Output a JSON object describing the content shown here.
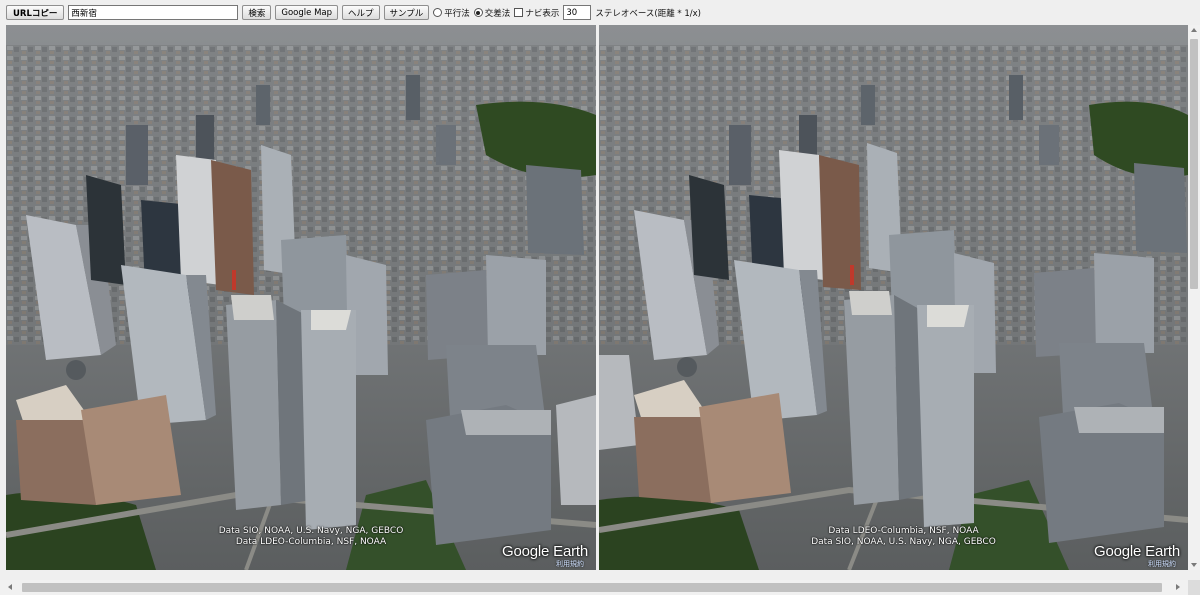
{
  "toolbar": {
    "url_copy_label": "URLコピー",
    "search_value": "西新宿",
    "search_button_label": "検索",
    "google_map_label": "Google Map",
    "help_label": "ヘルプ",
    "sample_label": "サンプル",
    "parallel_label": "平行法",
    "parallel_selected": false,
    "cross_label": "交差法",
    "cross_selected": true,
    "navi_label": "ナビ表示",
    "navi_checked": false,
    "stereo_base_value": "30",
    "stereo_base_label": "ステレオベース(距離 * 1/x)"
  },
  "left_view": {
    "attribution_line1": "Data SIO, NOAA, U.S. Navy, NGA, GEBCO",
    "attribution_line2": "Data LDEO-Columbia, NSF, NOAA",
    "logo_google": "Google",
    "logo_earth": "Earth",
    "map_link": "利用規約"
  },
  "right_view": {
    "attribution_line1": "Data LDEO-Columbia, NSF, NOAA",
    "attribution_line2": "Data SIO, NOAA, U.S. Navy, NGA, GEBCO",
    "logo_google": "Google",
    "logo_earth": "Earth",
    "map_link": "利用規約"
  },
  "colors": {
    "toolbar_bg": "#efefef",
    "city_base": "#6b6e70",
    "park_green": "#2f4a22",
    "tower_gray": "#9a9ea3"
  },
  "icons": {
    "scroll_up": "triangle-up-icon",
    "scroll_down": "triangle-down-icon",
    "scroll_left": "triangle-left-icon",
    "scroll_right": "triangle-right-icon"
  }
}
